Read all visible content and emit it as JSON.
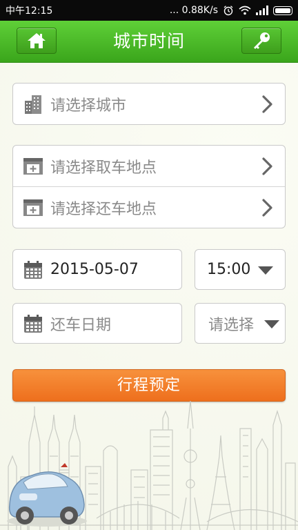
{
  "status_bar": {
    "time": "中午12:15",
    "speed": "... 0.88K/s"
  },
  "header": {
    "title": "城市时间",
    "home_icon": "home-icon",
    "key_icon": "key-icon",
    "accent": "#46b424"
  },
  "city": {
    "placeholder": "请选择城市",
    "icon": "building-icon"
  },
  "locations": {
    "pickup_placeholder": "请选择取车地点",
    "return_placeholder": "请选择还车地点",
    "icon": "store-icon"
  },
  "pickup": {
    "date": "2015-05-07",
    "time": "15:00"
  },
  "return": {
    "date_placeholder": "还车日期",
    "time_placeholder": "请选择"
  },
  "book_button": {
    "label": "行程预定",
    "color": "#f07d2a"
  }
}
